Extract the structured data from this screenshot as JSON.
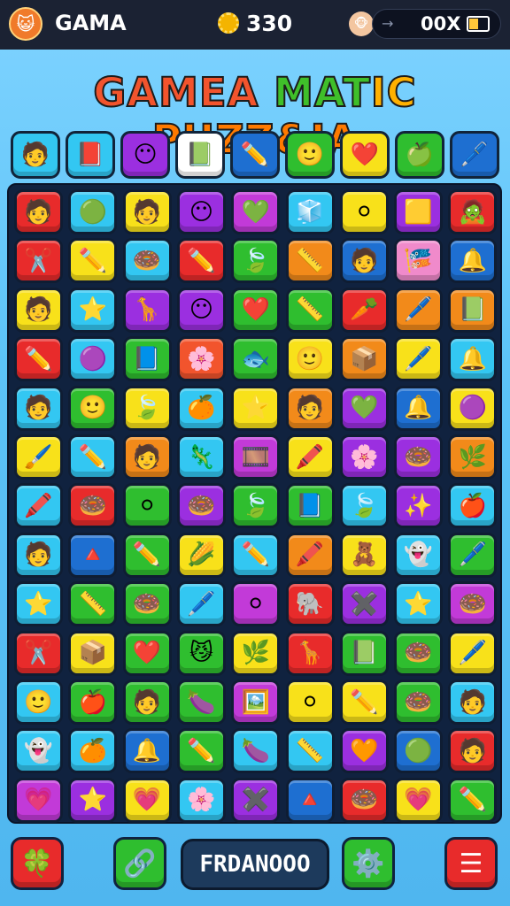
{
  "header": {
    "title": "GAMA",
    "coins": "330",
    "multiplier": "00X",
    "avatar_icon": "😺",
    "coin_icon": "gear-coin-icon",
    "face_icon": "🐵",
    "arrow_icon": "→",
    "battery_level": 0.5
  },
  "game_title": {
    "text_parts": [
      "GAMEA ",
      "MAT",
      "IC ",
      "PUZZ&IA"
    ],
    "colors": [
      "#f2542d",
      "#3fbf2a",
      "#ffb100",
      "#ff7a00"
    ]
  },
  "tray": [
    {
      "icon": "🧑",
      "bg": "#33c7f2"
    },
    {
      "icon": "📕",
      "bg": "#33c7f2"
    },
    {
      "icon": "😶",
      "bg": "#9b2fe0"
    },
    {
      "icon": "📗",
      "bg": "#ffffff"
    },
    {
      "icon": "✏️",
      "bg": "#1e6fd1"
    },
    {
      "icon": "🙂",
      "bg": "#2fbe2f"
    },
    {
      "icon": "❤️",
      "bg": "#f8e11a"
    },
    {
      "icon": "🍏",
      "bg": "#2fbe2f"
    },
    {
      "icon": "🖊️",
      "bg": "#1e6fd1"
    }
  ],
  "board": [
    [
      {
        "i": "🧑",
        "c": "#e82b2b"
      },
      {
        "i": "🟢",
        "c": "#33c7f2"
      },
      {
        "i": "🧑",
        "c": "#f8e11a"
      },
      {
        "i": "😶",
        "c": "#9b2fe0"
      },
      {
        "i": "💚",
        "c": "#c23ad8"
      },
      {
        "i": "🧊",
        "c": "#33c7f2"
      },
      {
        "i": "⚪",
        "c": "#f8e11a"
      },
      {
        "i": "🟨",
        "c": "#9b2fe0"
      },
      {
        "i": "🧟",
        "c": "#e82b2b"
      }
    ],
    [
      {
        "i": "✂️",
        "c": "#e82b2b"
      },
      {
        "i": "✏️",
        "c": "#f8e11a"
      },
      {
        "i": "🍩",
        "c": "#33c7f2"
      },
      {
        "i": "✏️",
        "c": "#e82b2b"
      },
      {
        "i": "🍃",
        "c": "#2fbe2f"
      },
      {
        "i": "📏",
        "c": "#f28a1a"
      },
      {
        "i": "🧑",
        "c": "#1e6fd1"
      },
      {
        "i": "🎏",
        "c": "#f08acb"
      },
      {
        "i": "🔔",
        "c": "#1e6fd1"
      }
    ],
    [
      {
        "i": "🧑",
        "c": "#f8e11a"
      },
      {
        "i": "⭐",
        "c": "#33c7f2"
      },
      {
        "i": "🦒",
        "c": "#9b2fe0"
      },
      {
        "i": "😶",
        "c": "#9b2fe0"
      },
      {
        "i": "❤️",
        "c": "#2fbe2f"
      },
      {
        "i": "📏",
        "c": "#2fbe2f"
      },
      {
        "i": "🥕",
        "c": "#e82b2b"
      },
      {
        "i": "🖊️",
        "c": "#f28a1a"
      },
      {
        "i": "📗",
        "c": "#f28a1a"
      }
    ],
    [
      {
        "i": "✏️",
        "c": "#e82b2b"
      },
      {
        "i": "🟣",
        "c": "#33c7f2"
      },
      {
        "i": "📘",
        "c": "#2fbe2f"
      },
      {
        "i": "🌸",
        "c": "#f2542d"
      },
      {
        "i": "🐟",
        "c": "#2fbe2f"
      },
      {
        "i": "🙂",
        "c": "#f8e11a"
      },
      {
        "i": "📦",
        "c": "#f28a1a"
      },
      {
        "i": "🖊️",
        "c": "#f8e11a"
      },
      {
        "i": "🔔",
        "c": "#33c7f2"
      }
    ],
    [
      {
        "i": "🧑",
        "c": "#33c7f2"
      },
      {
        "i": "🙂",
        "c": "#2fbe2f"
      },
      {
        "i": "🍃",
        "c": "#f8e11a"
      },
      {
        "i": "🍊",
        "c": "#33c7f2"
      },
      {
        "i": "⭐",
        "c": "#f8e11a"
      },
      {
        "i": "🧑",
        "c": "#f28a1a"
      },
      {
        "i": "💚",
        "c": "#9b2fe0"
      },
      {
        "i": "🔔",
        "c": "#1e6fd1"
      },
      {
        "i": "🟣",
        "c": "#f8e11a"
      }
    ],
    [
      {
        "i": "🖌️",
        "c": "#f8e11a"
      },
      {
        "i": "✏️",
        "c": "#33c7f2"
      },
      {
        "i": "🧑",
        "c": "#f28a1a"
      },
      {
        "i": "🦎",
        "c": "#33c7f2"
      },
      {
        "i": "🎞️",
        "c": "#c23ad8"
      },
      {
        "i": "🖍️",
        "c": "#f8e11a"
      },
      {
        "i": "🌸",
        "c": "#9b2fe0"
      },
      {
        "i": "🍩",
        "c": "#9b2fe0"
      },
      {
        "i": "🌿",
        "c": "#f28a1a"
      }
    ],
    [
      {
        "i": "🖍️",
        "c": "#33c7f2"
      },
      {
        "i": "🍩",
        "c": "#e82b2b"
      },
      {
        "i": "⚪",
        "c": "#2fbe2f"
      },
      {
        "i": "🍩",
        "c": "#9b2fe0"
      },
      {
        "i": "🍃",
        "c": "#2fbe2f"
      },
      {
        "i": "📘",
        "c": "#2fbe2f"
      },
      {
        "i": "🍃",
        "c": "#33c7f2"
      },
      {
        "i": "✨",
        "c": "#9b2fe0"
      },
      {
        "i": "🍎",
        "c": "#33c7f2"
      }
    ],
    [
      {
        "i": "🧑",
        "c": "#33c7f2"
      },
      {
        "i": "🔺",
        "c": "#1e6fd1"
      },
      {
        "i": "✏️",
        "c": "#2fbe2f"
      },
      {
        "i": "🌽",
        "c": "#f8e11a"
      },
      {
        "i": "✏️",
        "c": "#33c7f2"
      },
      {
        "i": "🖍️",
        "c": "#f28a1a"
      },
      {
        "i": "🧸",
        "c": "#f8e11a"
      },
      {
        "i": "👻",
        "c": "#33c7f2"
      },
      {
        "i": "🖊️",
        "c": "#2fbe2f"
      }
    ],
    [
      {
        "i": "⭐",
        "c": "#33c7f2"
      },
      {
        "i": "📏",
        "c": "#2fbe2f"
      },
      {
        "i": "🍩",
        "c": "#2fbe2f"
      },
      {
        "i": "🖊️",
        "c": "#33c7f2"
      },
      {
        "i": "⚪",
        "c": "#c23ad8"
      },
      {
        "i": "🐘",
        "c": "#e82b2b"
      },
      {
        "i": "✖️",
        "c": "#9b2fe0"
      },
      {
        "i": "⭐",
        "c": "#33c7f2"
      },
      {
        "i": "🍩",
        "c": "#c23ad8"
      }
    ],
    [
      {
        "i": "✂️",
        "c": "#e82b2b"
      },
      {
        "i": "📦",
        "c": "#f8e11a"
      },
      {
        "i": "❤️",
        "c": "#2fbe2f"
      },
      {
        "i": "😼",
        "c": "#2fbe2f"
      },
      {
        "i": "🌿",
        "c": "#f8e11a"
      },
      {
        "i": "🦒",
        "c": "#e82b2b"
      },
      {
        "i": "📗",
        "c": "#2fbe2f"
      },
      {
        "i": "🍩",
        "c": "#2fbe2f"
      },
      {
        "i": "🖊️",
        "c": "#f8e11a"
      }
    ],
    [
      {
        "i": "🙂",
        "c": "#33c7f2"
      },
      {
        "i": "🍎",
        "c": "#2fbe2f"
      },
      {
        "i": "🧑",
        "c": "#2fbe2f"
      },
      {
        "i": "🍆",
        "c": "#2fbe2f"
      },
      {
        "i": "🖼️",
        "c": "#c23ad8"
      },
      {
        "i": "⚪",
        "c": "#f8e11a"
      },
      {
        "i": "✏️",
        "c": "#f8e11a"
      },
      {
        "i": "🍩",
        "c": "#2fbe2f"
      },
      {
        "i": "🧑",
        "c": "#33c7f2"
      }
    ],
    [
      {
        "i": "👻",
        "c": "#33c7f2"
      },
      {
        "i": "🍊",
        "c": "#33c7f2"
      },
      {
        "i": "🔔",
        "c": "#1e6fd1"
      },
      {
        "i": "✏️",
        "c": "#2fbe2f"
      },
      {
        "i": "🍆",
        "c": "#33c7f2"
      },
      {
        "i": "📏",
        "c": "#33c7f2"
      },
      {
        "i": "🧡",
        "c": "#9b2fe0"
      },
      {
        "i": "🟢",
        "c": "#1e6fd1"
      },
      {
        "i": "🧑",
        "c": "#e82b2b"
      }
    ],
    [
      {
        "i": "💗",
        "c": "#c23ad8"
      },
      {
        "i": "⭐",
        "c": "#9b2fe0"
      },
      {
        "i": "💗",
        "c": "#f8e11a"
      },
      {
        "i": "🌸",
        "c": "#33c7f2"
      },
      {
        "i": "✖️",
        "c": "#9b2fe0"
      },
      {
        "i": "🔺",
        "c": "#1e6fd1"
      },
      {
        "i": "🍩",
        "c": "#e82b2b"
      },
      {
        "i": "💗",
        "c": "#f8e11a"
      },
      {
        "i": "✏️",
        "c": "#2fbe2f"
      }
    ]
  ],
  "footer": {
    "left_icon": "🍀",
    "hint_icon": "🔗",
    "level_text": "FRDANOOO",
    "settings_icon": "⚙️",
    "menu_icon": "☰"
  }
}
